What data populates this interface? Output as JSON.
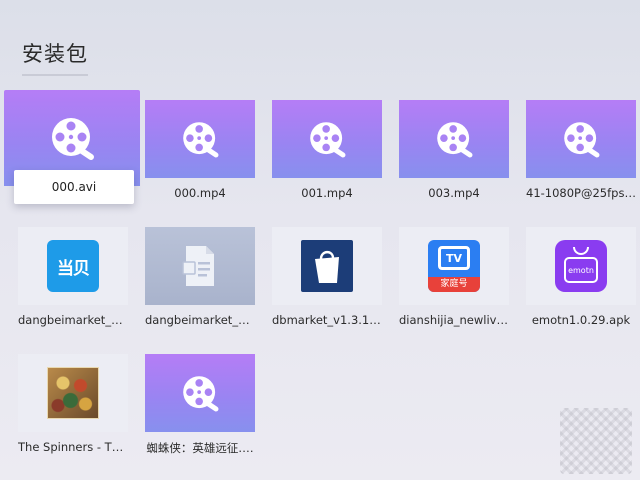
{
  "page": {
    "title": "安装包"
  },
  "items": [
    {
      "name": "000.avi",
      "kind": "video"
    },
    {
      "name": "000.mp4",
      "kind": "video"
    },
    {
      "name": "001.mp4",
      "kind": "video"
    },
    {
      "name": "003.mp4",
      "kind": "video"
    },
    {
      "name": "41-1080P@25fps-4…",
      "kind": "video"
    },
    {
      "name": "dangbeimarket_4.3…",
      "kind": "apk",
      "icon_text": "当贝"
    },
    {
      "name": "dangbeimarket_4.3…",
      "kind": "file"
    },
    {
      "name": "dbmarket_v1.3.1_2…",
      "kind": "apk"
    },
    {
      "name": "dianshijia_newlive_…",
      "kind": "apk",
      "icon_text": "TV",
      "icon_caption": "家庭号"
    },
    {
      "name": "emotn1.0.29.apk",
      "kind": "apk",
      "icon_text": "emotn"
    },
    {
      "name": "The Spinners - The…",
      "kind": "image"
    },
    {
      "name": "蜘蛛侠：英雄远征.…",
      "kind": "video"
    }
  ],
  "icons": {
    "video": "film-reel-play-icon",
    "file": "document-icon",
    "dangbei": "dangbei-app-icon",
    "dbmarket": "shopping-bag-app-icon",
    "dianshijia": "tv-app-icon",
    "emotn": "emotn-bag-app-icon",
    "album": "album-cover-icon"
  },
  "colors": {
    "video_top": "#b57df6",
    "video_bottom": "#8790ee",
    "dangbei_blue": "#1e9be8",
    "dbmarket_navy": "#1c3d78",
    "dianshijia_blue": "#2b7ef2",
    "dianshijia_red": "#e8413a",
    "emotn_purple": "#8a3cf0"
  }
}
